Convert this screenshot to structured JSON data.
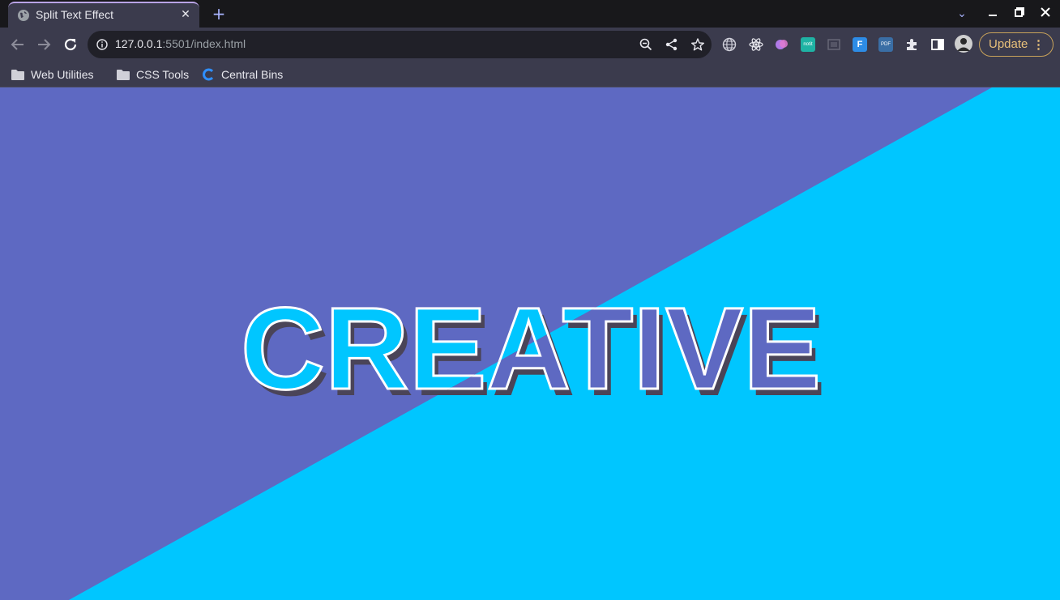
{
  "browser": {
    "tab": {
      "title": "Split Text Effect",
      "close_glyph": "✕"
    },
    "new_tab_glyph": "+",
    "window_controls": {
      "dropdown": "⌄",
      "minimize": "—",
      "restore": "❐",
      "close": "✕"
    },
    "address": {
      "host": "127.0.0.1",
      "rest": ":5501/index.html"
    },
    "update_label": "Update",
    "update_menu_glyph": "⋮",
    "bookmarks": [
      {
        "label": "Web Utilities",
        "icon": "folder-icon"
      },
      {
        "label": "CSS Tools",
        "icon": "folder-icon"
      },
      {
        "label": "Central Bins",
        "icon": "central-bins-icon"
      }
    ],
    "extension_labels": {
      "notion": "notit",
      "pdf": "PDF",
      "figma": "F"
    }
  },
  "page": {
    "headline": "CREATIVE",
    "colors": {
      "primary": "#5e69c2",
      "secondary": "#00c6ff",
      "outline": "#ffffff",
      "shadow": "#4a4458"
    }
  }
}
